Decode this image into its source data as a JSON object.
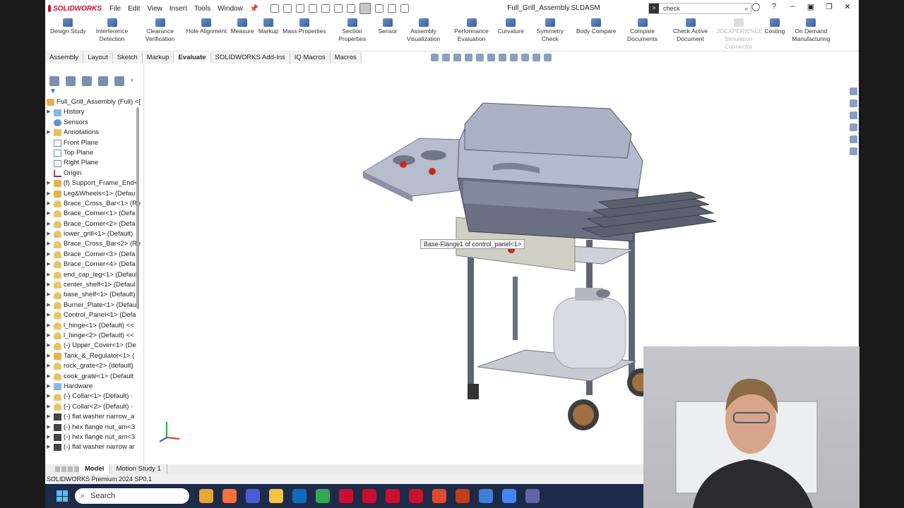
{
  "titlebar": {
    "brand": "SOLIDWORKS",
    "menus": [
      "File",
      "Edit",
      "View",
      "Insert",
      "Tools",
      "Window"
    ],
    "document_title": "Full_Grill_Assembly.SLDASM",
    "search": {
      "term_icon": ">",
      "value": "check"
    }
  },
  "ribbon": {
    "buttons": [
      {
        "label": "Design Study",
        "icon": "design-study-icon"
      },
      {
        "label": "Interference Detection",
        "icon": "interference-icon"
      },
      {
        "label": "Clearance Verification",
        "icon": "clearance-icon"
      },
      {
        "label": "Hole Alignment",
        "icon": "hole-alignment-icon"
      },
      {
        "label": "Measure",
        "icon": "measure-icon"
      },
      {
        "label": "Markup",
        "icon": "markup-icon"
      },
      {
        "label": "Mass Properties",
        "icon": "mass-properties-icon"
      },
      {
        "label": "Section Properties",
        "icon": "section-properties-icon"
      },
      {
        "label": "Sensor",
        "icon": "sensor-icon"
      },
      {
        "label": "Assembly Visualization",
        "icon": "assembly-visualization-icon"
      },
      {
        "label": "Performance Evaluation",
        "icon": "performance-icon"
      },
      {
        "label": "Curvature",
        "icon": "curvature-icon"
      },
      {
        "label": "Symmetry Check",
        "icon": "symmetry-icon"
      },
      {
        "label": "Body Compare",
        "icon": "body-compare-icon"
      },
      {
        "label": "Compare Documents",
        "icon": "compare-documents-icon"
      },
      {
        "label": "Check Active Document",
        "icon": "check-document-icon"
      },
      {
        "label": "3DEXPERIENCE Simulation Connector",
        "icon": "simulation-connector-icon",
        "disabled": true
      },
      {
        "label": "Costing",
        "icon": "costing-icon"
      },
      {
        "label": "On Demand Manufacturing",
        "icon": "manufacturing-icon"
      }
    ]
  },
  "tabs": [
    "Assembly",
    "Layout",
    "Sketch",
    "Markup",
    "Evaluate",
    "SOLIDWORKS Add-Ins",
    "IQ Macros",
    "Macros"
  ],
  "active_tab": "Evaluate",
  "tree": {
    "root": "Full_Grill_Assembly (Full) <[",
    "items": [
      {
        "label": "History",
        "icon": "folder",
        "expandable": true
      },
      {
        "label": "Sensors",
        "icon": "sensor",
        "expandable": false
      },
      {
        "label": "Annotations",
        "icon": "annot",
        "expandable": true
      },
      {
        "label": "Front Plane",
        "icon": "plane",
        "expandable": false
      },
      {
        "label": "Top Plane",
        "icon": "plane",
        "expandable": false
      },
      {
        "label": "Right Plane",
        "icon": "plane",
        "expandable": false
      },
      {
        "label": "Origin",
        "icon": "origin",
        "expandable": false
      },
      {
        "label": "(f) Support_Frame_End<",
        "icon": "asm",
        "expandable": true
      },
      {
        "label": "Leg&Wheels<1> (Defau",
        "icon": "asm",
        "expandable": true
      },
      {
        "label": "Brace_Cross_Bar<1> (Re",
        "icon": "part",
        "expandable": true
      },
      {
        "label": "Brace_Corner<1> (Defa",
        "icon": "part",
        "expandable": true
      },
      {
        "label": "Brace_Corner<2> (Defa",
        "icon": "part",
        "expandable": true
      },
      {
        "label": "lower_grill<1> (Default)",
        "icon": "part",
        "expandable": true
      },
      {
        "label": "Brace_Cross_Bar<2> (Re",
        "icon": "part",
        "expandable": true
      },
      {
        "label": "Brace_Corner<3> (Defa",
        "icon": "part",
        "expandable": true
      },
      {
        "label": "Brace_Corner<4> (Defa",
        "icon": "part",
        "expandable": true
      },
      {
        "label": "end_cap_leg<1> (Defaul",
        "icon": "part",
        "expandable": true
      },
      {
        "label": "center_shelf<1> (Defaul",
        "icon": "part",
        "expandable": true
      },
      {
        "label": "base_shelf<1> (Default)",
        "icon": "part",
        "expandable": true
      },
      {
        "label": "Burner_Plate<1> (Defau",
        "icon": "part",
        "expandable": true
      },
      {
        "label": "Control_Panel<1> (Defa",
        "icon": "part",
        "expandable": true
      },
      {
        "label": "l_hinge<1> (Default) <<",
        "icon": "part",
        "expandable": true
      },
      {
        "label": "l_hinge<2> (Default) <<",
        "icon": "part",
        "expandable": true
      },
      {
        "label": "(-) Upper_Cover<1> (De",
        "icon": "part",
        "expandable": true
      },
      {
        "label": "Tank_&_Regulator<1> (",
        "icon": "asm",
        "expandable": true
      },
      {
        "label": "rock_grate<2> (default)",
        "icon": "part",
        "expandable": true
      },
      {
        "label": "cook_grate<1> (Default",
        "icon": "part",
        "expandable": true
      },
      {
        "label": "Hardware",
        "icon": "folder",
        "expandable": true
      },
      {
        "label": "(-) Collar<1> (Default) ·",
        "icon": "part",
        "expandable": true
      },
      {
        "label": "(-) Collar<2> (Default) ·",
        "icon": "part",
        "expandable": true
      },
      {
        "label": "(-) flat washer narrow_a",
        "icon": "hw",
        "expandable": true
      },
      {
        "label": "(-) hex flange nut_am<3",
        "icon": "hw",
        "expandable": true
      },
      {
        "label": "(-) hex flange nut_am<3",
        "icon": "hw",
        "expandable": true
      },
      {
        "label": "(-) flat washer narrow ar",
        "icon": "hw",
        "expandable": true
      }
    ]
  },
  "viewport": {
    "tooltip": "Base-Flange1 of control_panel<1>",
    "triad_axes": [
      "y",
      "x",
      "z"
    ]
  },
  "bottom_tabs": [
    "Model",
    "Motion Study 1"
  ],
  "active_bottom_tab": "Model",
  "status": "SOLIDWORKS Premium 2024 SP0.1",
  "taskbar": {
    "search_placeholder": "Search",
    "apps": [
      {
        "name": "file-explorer-icon",
        "color": "#e8a634"
      },
      {
        "name": "firefox-icon",
        "color": "#ff7139"
      },
      {
        "name": "zoom-icon",
        "color": "#4b5bd6"
      },
      {
        "name": "folder-icon",
        "color": "#f5c542"
      },
      {
        "name": "outlook-icon",
        "color": "#0f6cbd"
      },
      {
        "name": "chrome-icon",
        "color": "#34a853"
      },
      {
        "name": "solidworks-2021-icon",
        "color": "#c8102e"
      },
      {
        "name": "solidworks-2022-icon",
        "color": "#c8102e"
      },
      {
        "name": "solidworks-2023-icon",
        "color": "#c8102e"
      },
      {
        "name": "solidworks-2024-icon",
        "color": "#c8102e"
      },
      {
        "name": "snip-icon",
        "color": "#e04a2f"
      },
      {
        "name": "powerpoint-icon",
        "color": "#c43e1c"
      },
      {
        "name": "paint-icon",
        "color": "#3f7fd9"
      },
      {
        "name": "chrome-profile-icon",
        "color": "#4285f4"
      },
      {
        "name": "teams-icon",
        "color": "#6264a7"
      }
    ]
  },
  "colors": {
    "brand_red": "#c8102e",
    "taskbar": "#1d2a48",
    "grill_body": "#b6bccd",
    "frame": "#585e6a"
  }
}
